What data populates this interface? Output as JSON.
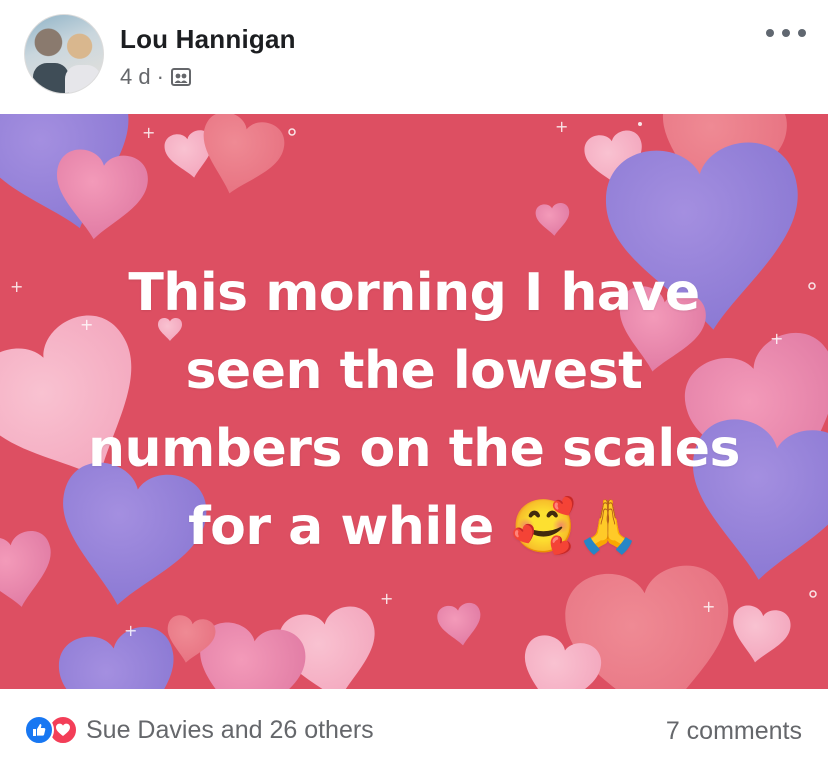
{
  "post": {
    "author": "Lou Hannigan",
    "time": "4 d",
    "separator": "·",
    "audience_icon": "friends-icon",
    "more_icon": "more-icon",
    "text_lines": [
      "This morning I have",
      "seen the lowest",
      "numbers on the scales",
      "for a while 🥰🙏"
    ],
    "background": {
      "base_color": "#dd4f62",
      "heart_colors": [
        "#9b87d9",
        "#e56c9c",
        "#f7b3c8",
        "#ef8190"
      ]
    }
  },
  "footer": {
    "reaction_icons": [
      "like-icon",
      "love-icon"
    ],
    "reactions_text": "Sue Davies and 26 others",
    "comments_text": "7 comments"
  }
}
